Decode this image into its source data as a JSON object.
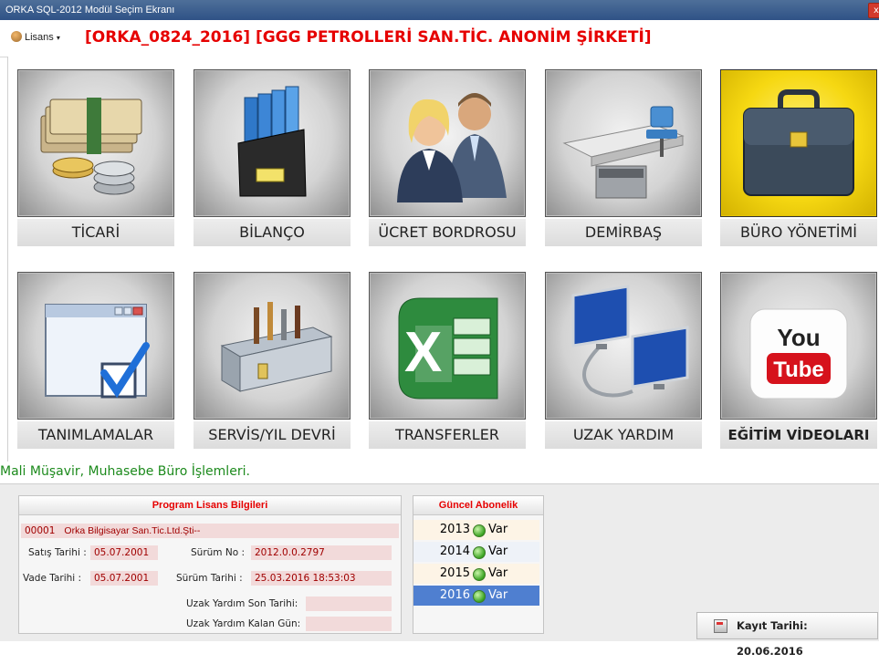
{
  "window": {
    "title": "ORKA SQL-2012  Modül Seçim Ekranı",
    "close_glyph": "x"
  },
  "topbar": {
    "lisans_label": "Lisans",
    "company": "[ORKA_0824_2016] [GGG PETROLLERİ SAN.TİC. ANONİM ŞİRKETİ]"
  },
  "modules": [
    {
      "label": "TİCARİ",
      "icon": "money-stack-icon"
    },
    {
      "label": "BİLANÇO",
      "icon": "binder-folders-icon"
    },
    {
      "label": "ÜCRET BORDROSU",
      "icon": "people-icon"
    },
    {
      "label": "DEMİRBAŞ",
      "icon": "office-desk-icon"
    },
    {
      "label": "BÜRO YÖNETİMİ",
      "icon": "briefcase-icon",
      "active": true
    },
    {
      "label": "TANIMLAMALAR",
      "icon": "window-checkmark-icon"
    },
    {
      "label": "SERVİS/YIL DEVRİ",
      "icon": "toolbox-icon"
    },
    {
      "label": "TRANSFERLER",
      "icon": "excel-icon"
    },
    {
      "label": "UZAK YARDIM",
      "icon": "remote-computers-icon"
    },
    {
      "label": "EĞİTİM VİDEOLARI",
      "icon": "youtube-icon"
    }
  ],
  "youtube": {
    "you": "You",
    "tube": "Tube"
  },
  "status": "Mali Müşavir, Muhasebe Büro İşlemleri.",
  "license": {
    "header": "Program Lisans Bilgileri",
    "code": "00001",
    "company": "Orka Bilgisayar San.Tic.Ltd.Şti--",
    "satis_label": "Satış Tarihi :",
    "satis_value": "05.07.2001",
    "surum_no_label": "Sürüm No :",
    "surum_no_value": "2012.0.0.2797",
    "vade_label": "Vade Tarihi :",
    "vade_value": "05.07.2001",
    "surum_tarihi_label": "Sürüm Tarihi :",
    "surum_tarihi_value": "25.03.2016 18:53:03",
    "uzak_son_label": "Uzak Yardım Son Tarihi:",
    "uzak_son_value": "",
    "uzak_kalan_label": "Uzak Yardım Kalan Gün:",
    "uzak_kalan_value": ""
  },
  "abonelik": {
    "header": "Güncel Abonelik",
    "rows": [
      {
        "year": "2013",
        "status": "Var"
      },
      {
        "year": "2014",
        "status": "Var"
      },
      {
        "year": "2015",
        "status": "Var"
      },
      {
        "year": "2016",
        "status": "Var",
        "selected": true
      }
    ]
  },
  "kayit": {
    "text": "Kayıt Tarihi: 20.06.2016"
  },
  "colors": {
    "title_red": "#e60000",
    "status_green": "#1c8a1c",
    "active_tile": "#f6d812",
    "selected_row": "#4f7fd0"
  }
}
